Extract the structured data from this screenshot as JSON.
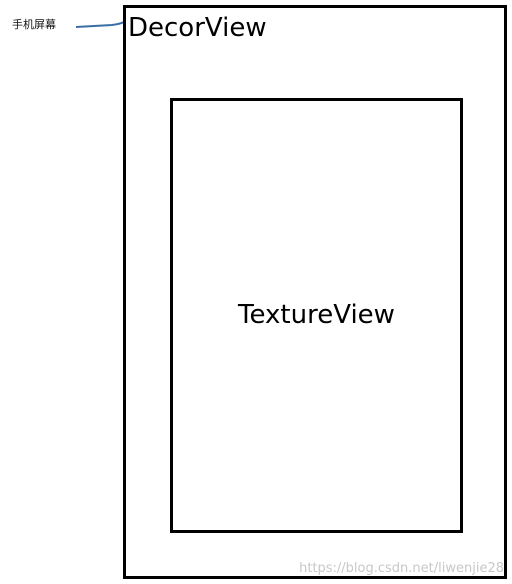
{
  "callout": {
    "label": "手机屏幕",
    "line_color": "#3a6ea5"
  },
  "decor_view": {
    "label": "DecorView"
  },
  "texture_view": {
    "label": "TextureView"
  },
  "watermark": {
    "text": "https://blog.csdn.net/liwenjie28"
  }
}
